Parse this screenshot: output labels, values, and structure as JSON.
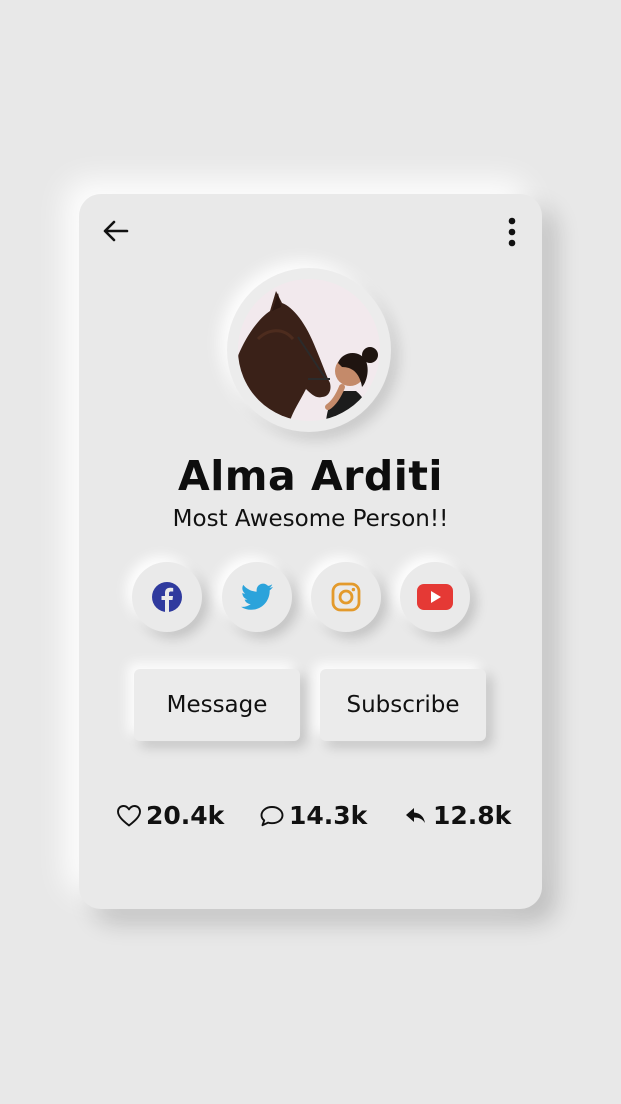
{
  "profile": {
    "name": "Alma Arditi",
    "tagline": "Most Awesome Person!!"
  },
  "social": [
    {
      "name": "facebook",
      "icon": "facebook-icon",
      "color": "#2f3a9e"
    },
    {
      "name": "twitter",
      "icon": "twitter-icon",
      "color": "#2ba3db"
    },
    {
      "name": "instagram",
      "icon": "instagram-icon",
      "color": "#e39a2c"
    },
    {
      "name": "youtube",
      "icon": "youtube-icon",
      "color": "#e53935"
    }
  ],
  "actions": {
    "message_label": "Message",
    "subscribe_label": "Subscribe"
  },
  "stats": {
    "likes": "20.4k",
    "comments": "14.3k",
    "shares": "12.8k"
  },
  "icons": {
    "back": "arrow-left-icon",
    "menu": "more-vertical-icon"
  }
}
